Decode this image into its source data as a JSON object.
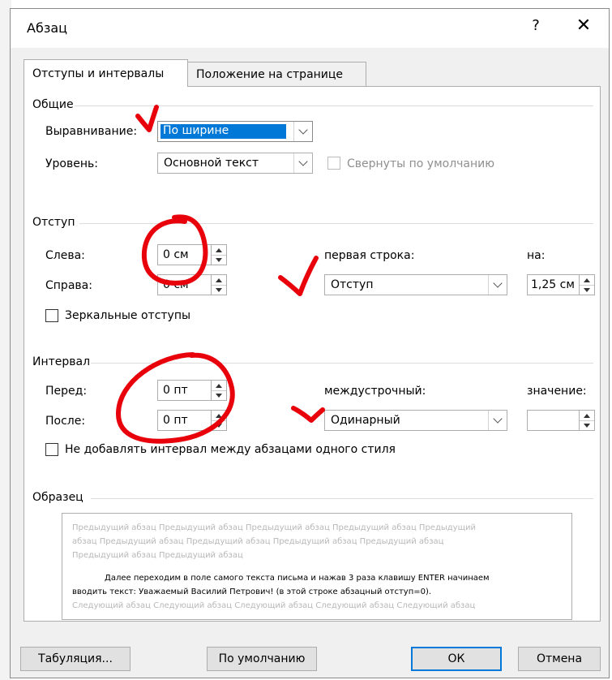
{
  "dialog": {
    "title": "Абзац",
    "help": "?",
    "close": "✕"
  },
  "tabs": [
    {
      "label": "Отступы и интервалы",
      "active": true
    },
    {
      "label": "Положение на странице",
      "active": false
    }
  ],
  "general": {
    "heading": "Общие",
    "alignment_label": "Выравнивание:",
    "alignment_value": "По ширине",
    "level_label": "Уровень:",
    "level_value": "Основной текст",
    "collapsed_label": "Свернуты по умолчанию"
  },
  "indent": {
    "heading": "Отступ",
    "left_label": "Слева:",
    "left_value": "0 см",
    "right_label": "Справа:",
    "right_value": "0 см",
    "first_line_label": "первая строка:",
    "first_line_value": "Отступ",
    "by_label": "на:",
    "by_value": "1,25 см",
    "mirror_label": "Зеркальные отступы"
  },
  "spacing": {
    "heading": "Интервал",
    "before_label": "Перед:",
    "before_value": "0 пт",
    "after_label": "После:",
    "after_value": "0 пт",
    "line_label": "междустрочный:",
    "line_value": "Одинарный",
    "at_label": "значение:",
    "at_value": "",
    "no_space_label": "Не добавлять интервал между абзацами одного стиля"
  },
  "preview": {
    "heading": "Образец",
    "prev_line1": "Предыдущий абзац Предыдущий абзац Предыдущий абзац Предыдущий абзац Предыдущий",
    "prev_line2": "абзац Предыдущий абзац Предыдущий абзац Предыдущий абзац Предыдущий абзац",
    "prev_line3": "Предыдущий абзац Предыдущий абзац",
    "main_line1": "Далее переходим в поле самого текста письма и нажав 3 раза клавишу ENTER начинаем",
    "main_line2": "вводить текст: Уважаемый Василий Петрович! (в этой строке абзацный отступ=0).",
    "next_line1": "Следующий абзац Следующий абзац Следующий абзац Следующий абзац Следующий абзац"
  },
  "buttons": {
    "tabs": "Табуляция...",
    "default": "По умолчанию",
    "ok": "ОК",
    "cancel": "Отмена"
  },
  "colors": {
    "selection": "#0078d7",
    "annotation": "#e8000b"
  }
}
